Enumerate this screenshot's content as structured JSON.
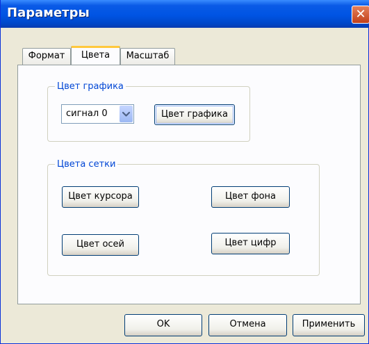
{
  "window": {
    "title": "Параметры",
    "close_glyph": "✕"
  },
  "tabs": [
    {
      "label": "Формат",
      "active": false
    },
    {
      "label": "Цвета",
      "active": true
    },
    {
      "label": "Масштаб",
      "active": false
    }
  ],
  "graph_color_group": {
    "title": "Цвет графика",
    "signal_select": {
      "value": "сигнал 0"
    },
    "color_button": "Цвет графика"
  },
  "grid_colors_group": {
    "title": "Цвета сетки",
    "cursor_button": "Цвет курсора",
    "background_button": "Цвет фона",
    "axes_button": "Цвет осей",
    "digits_button": "Цвет цифр"
  },
  "footer": {
    "ok": "OK",
    "cancel": "Отмена",
    "apply": "Применить"
  },
  "colors": {
    "titlebar": "#0054E3",
    "dialog_bg": "#ECE9D8",
    "group_title": "#0046D5",
    "close_button": "#D9552A"
  },
  "icons": [
    "close-icon",
    "chevron-down-icon"
  ]
}
